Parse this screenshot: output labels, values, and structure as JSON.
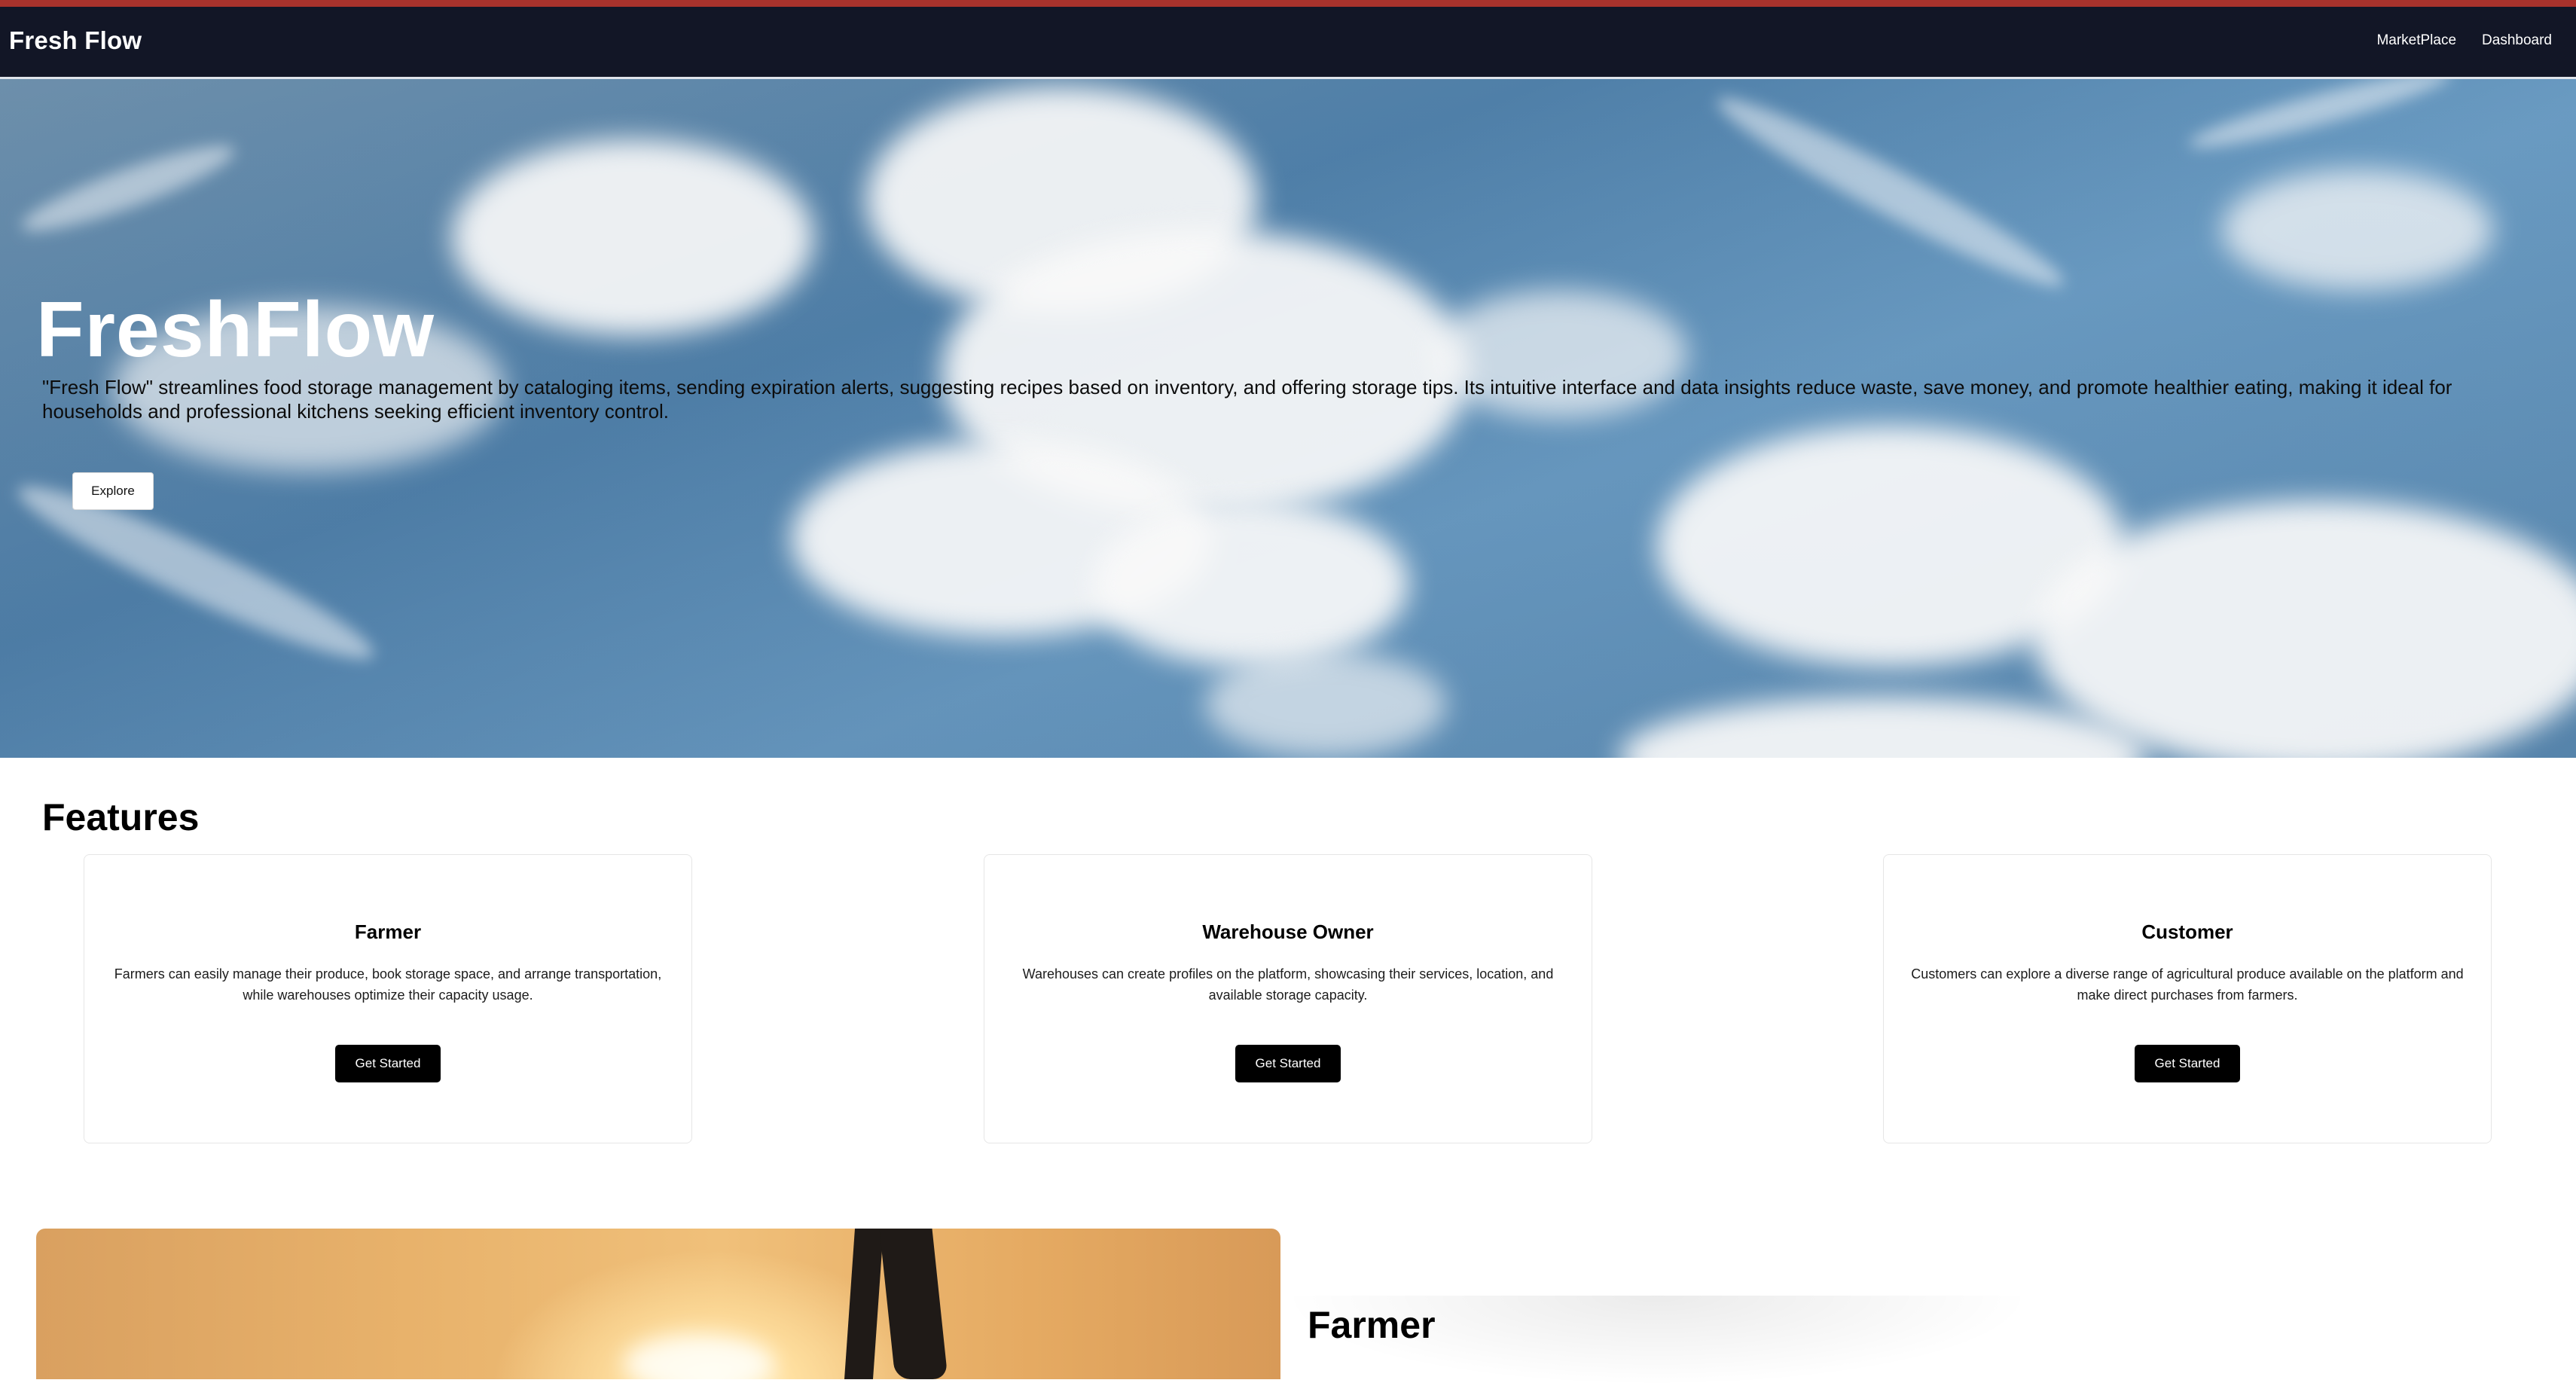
{
  "navbar": {
    "brand": "Fresh Flow",
    "links": [
      "MarketPlace",
      "Dashboard"
    ]
  },
  "hero": {
    "title": "FreshFlow",
    "description": "\"Fresh Flow\" streamlines food storage management by cataloging items, sending expiration alerts, suggesting recipes based on inventory, and offering storage tips. Its intuitive interface and data insights reduce waste, save money, and promote healthier eating, making it ideal for households and professional kitchens seeking efficient inventory control.",
    "explore_label": "Explore"
  },
  "features": {
    "title": "Features",
    "cards": [
      {
        "title": "Farmer",
        "text": "Farmers can easily manage their produce, book storage space, and arrange transportation, while warehouses optimize their capacity usage.",
        "button": "Get Started"
      },
      {
        "title": "Warehouse Owner",
        "text": "Warehouses can create profiles on the platform, showcasing their services, location, and available storage capacity.",
        "button": "Get Started"
      },
      {
        "title": "Customer",
        "text": "Customers can explore a diverse range of agricultural produce available on the platform and make direct purchases from farmers.",
        "button": "Get Started"
      }
    ]
  },
  "farmer_section": {
    "title": "Farmer"
  },
  "colors": {
    "navbar_bg": "#121626",
    "top_stripe": "#a8322c",
    "button_dark": "#000000"
  }
}
